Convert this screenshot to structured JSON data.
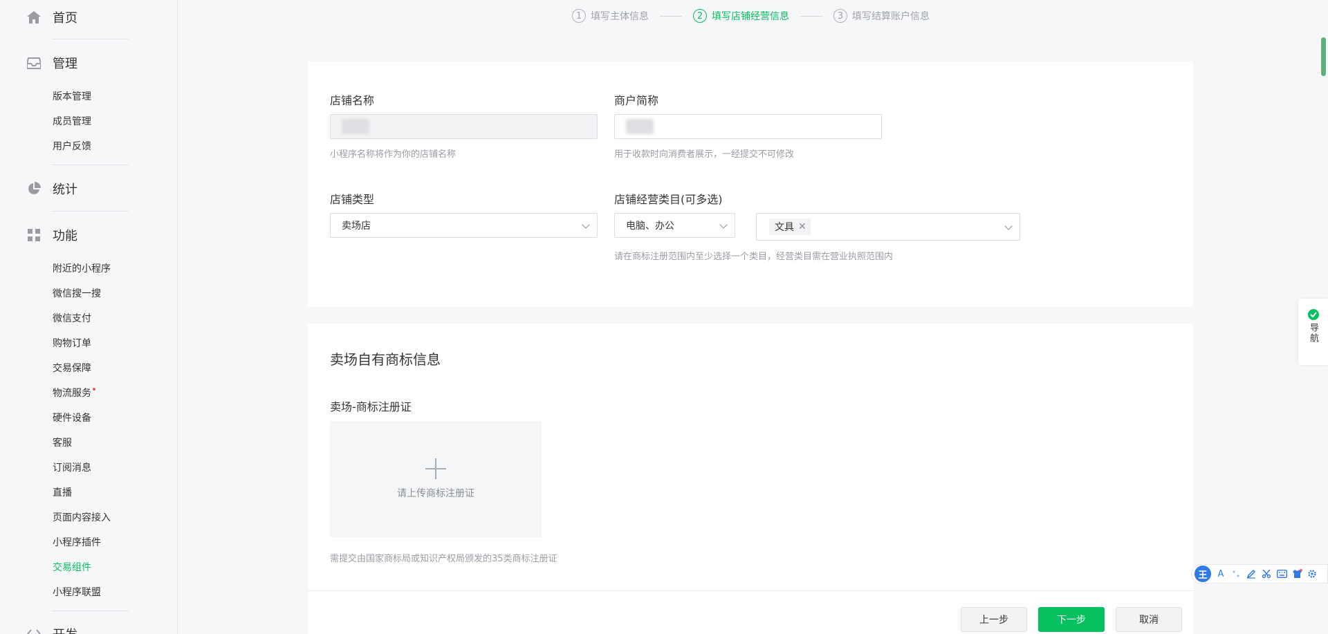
{
  "sidebar": {
    "home_label": "首页",
    "manage": {
      "label": "管理",
      "items": [
        "版本管理",
        "成员管理",
        "用户反馈"
      ]
    },
    "stats_label": "统计",
    "features": {
      "label": "功能",
      "items": [
        "附近的小程序",
        "微信搜一搜",
        "微信支付",
        "购物订单",
        "交易保障",
        "物流服务",
        "硬件设备",
        "客服",
        "订阅消息",
        "直播",
        "页面内容接入",
        "小程序插件",
        "交易组件",
        "小程序联盟"
      ]
    },
    "dev_label": "开发"
  },
  "steps": [
    {
      "num": "1",
      "label": "填写主体信息"
    },
    {
      "num": "2",
      "label": "填写店铺经营信息"
    },
    {
      "num": "3",
      "label": "填写结算账户信息"
    }
  ],
  "form": {
    "shop_name_label": "店铺名称",
    "shop_name_hint": "小程序名称将作为你的店铺名称",
    "merchant_short_label": "商户简称",
    "merchant_short_hint": "用于收款时向消费者展示，一经提交不可修改",
    "shop_type_label": "店铺类型",
    "shop_type_value": "卖场店",
    "category_label": "店铺经营类目(可多选)",
    "category_primary_value": "电脑、办公",
    "category_tag": "文具",
    "category_hint": "请在商标注册范围内至少选择一个类目，经营类目需在营业执照范围内"
  },
  "trademark": {
    "section_title": "卖场自有商标信息",
    "cert_label": "卖场-商标注册证",
    "upload_text": "请上传商标注册证",
    "hint": "需提交由国家商标局或知识产权局颁发的35类商标注册证"
  },
  "buttons": {
    "prev": "上一步",
    "next": "下一步",
    "cancel": "取消"
  },
  "float_nav": {
    "label": "导航"
  },
  "ime": {
    "logo": "王",
    "letter": "A"
  },
  "colors": {
    "accent": "#07c160",
    "text": "#353535",
    "hint": "#9a9da3",
    "page_bg": "#f6f7f9"
  }
}
